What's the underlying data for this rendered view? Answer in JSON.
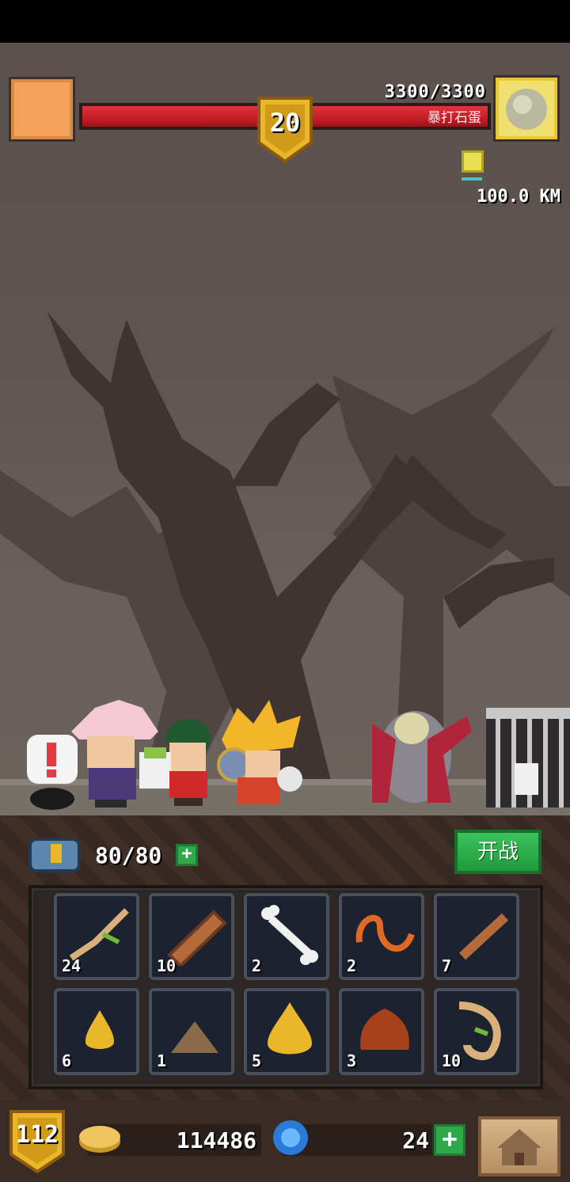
{
  "hud": {
    "hp_text": "3300/3300",
    "hp_fraction": 1.0,
    "enemy_name": "暴打石蛋",
    "stage_level": "20",
    "distance": "100.0 KM"
  },
  "party": {
    "bag_count": "80/80",
    "fight_label": "开战"
  },
  "inventory": {
    "items": [
      {
        "icon": "twig-icon",
        "qty": "24"
      },
      {
        "icon": "log-icon",
        "qty": "10"
      },
      {
        "icon": "bone-icon",
        "qty": "2"
      },
      {
        "icon": "worm-icon",
        "qty": "2"
      },
      {
        "icon": "stick-icon",
        "qty": "7"
      },
      {
        "icon": "small-resin-drop-icon",
        "qty": "6"
      },
      {
        "icon": "dirt-pile-icon",
        "qty": "1"
      },
      {
        "icon": "resin-drop-icon",
        "qty": "5"
      },
      {
        "icon": "chestnut-icon",
        "qty": "3"
      },
      {
        "icon": "root-icon",
        "qty": "10"
      }
    ]
  },
  "bottom": {
    "player_level": "112",
    "coins": "114486",
    "gems": "24"
  },
  "colors": {
    "hp_red": "#c51d26",
    "accent_green": "#2ea94a",
    "gold": "#e8b82a"
  }
}
